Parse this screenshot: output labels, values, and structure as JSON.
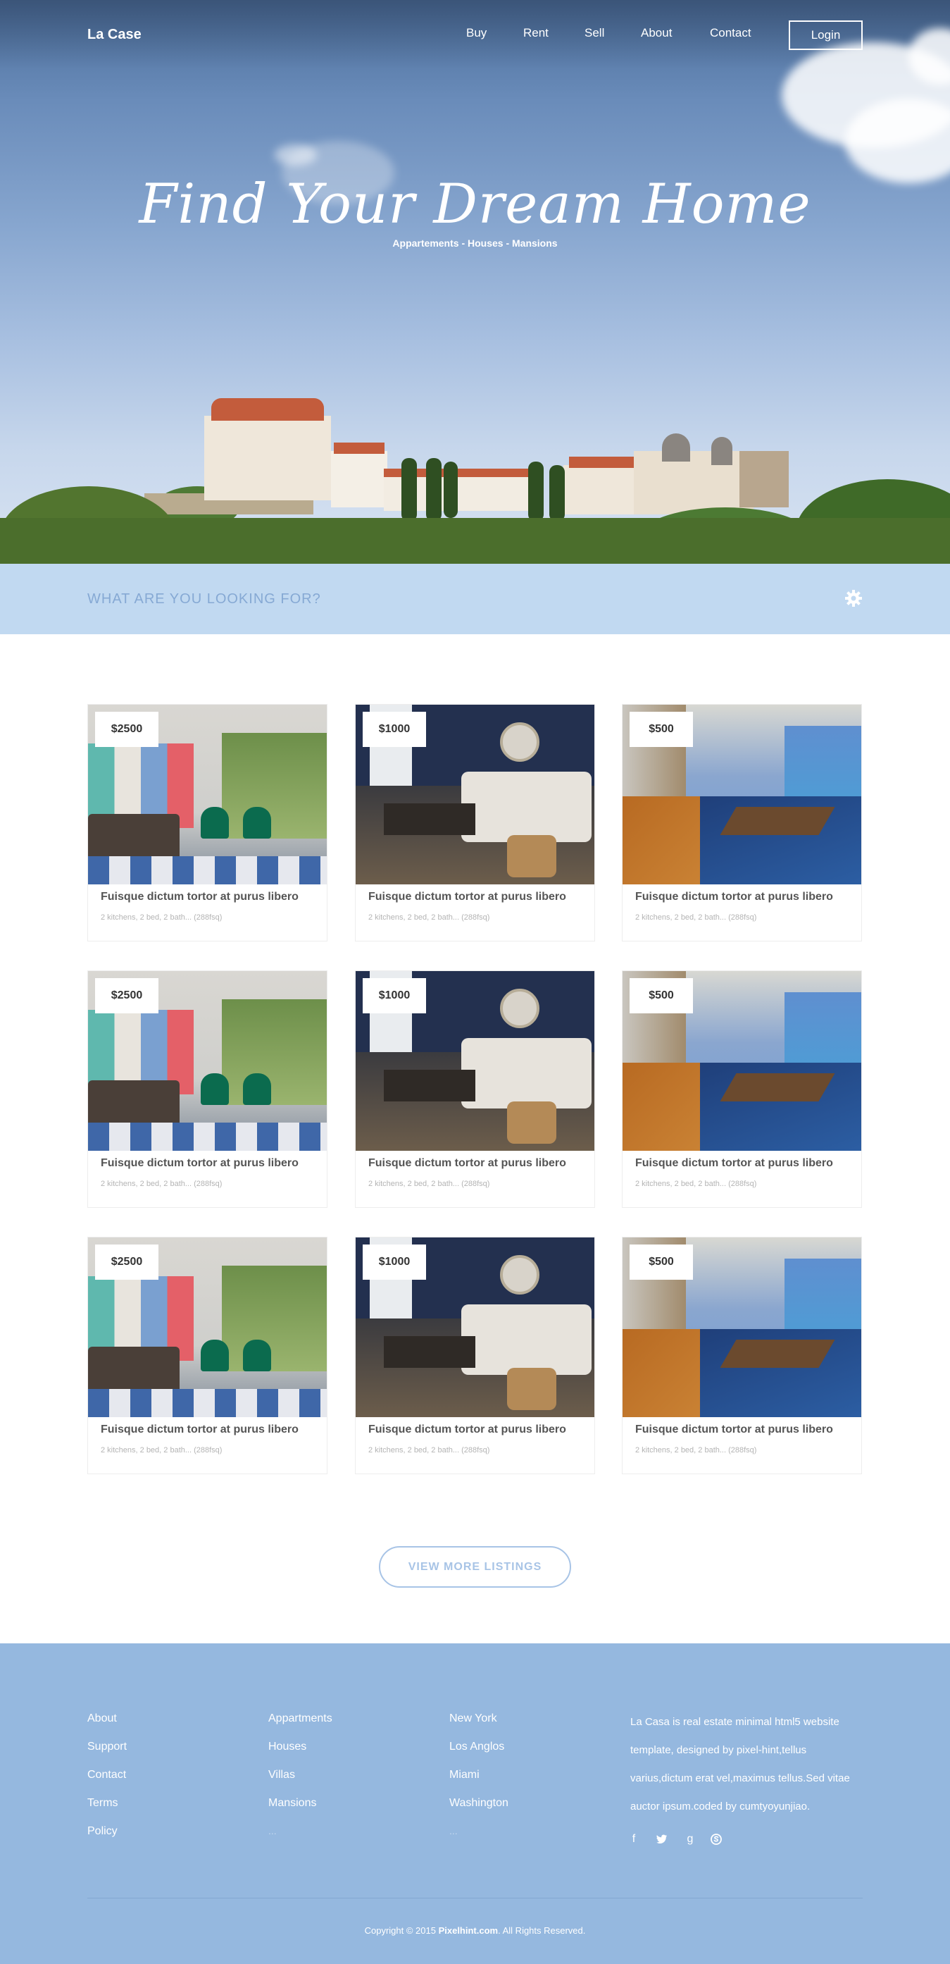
{
  "header": {
    "brand": "La Case",
    "nav": [
      "Buy",
      "Rent",
      "Sell",
      "About",
      "Contact"
    ],
    "login_label": "Login"
  },
  "hero": {
    "title": "Find Your Dream Home",
    "subtitle": "Appartements - Houses - Mansions"
  },
  "search": {
    "label": "WHAT ARE YOU LOOKING FOR?"
  },
  "listings": [
    {
      "price": "$2500",
      "title": "Fuisque dictum tortor at purus libero",
      "desc": "2 kitchens, 2 bed, 2 bath... (288fsq)"
    },
    {
      "price": "$1000",
      "title": "Fuisque dictum tortor at purus libero",
      "desc": "2 kitchens, 2 bed, 2 bath... (288fsq)"
    },
    {
      "price": "$500",
      "title": "Fuisque dictum tortor at purus libero",
      "desc": "2 kitchens, 2 bed, 2 bath... (288fsq)"
    },
    {
      "price": "$2500",
      "title": "Fuisque dictum tortor at purus libero",
      "desc": "2 kitchens, 2 bed, 2 bath... (288fsq)"
    },
    {
      "price": "$1000",
      "title": "Fuisque dictum tortor at purus libero",
      "desc": "2 kitchens, 2 bed, 2 bath... (288fsq)"
    },
    {
      "price": "$500",
      "title": "Fuisque dictum tortor at purus libero",
      "desc": "2 kitchens, 2 bed, 2 bath... (288fsq)"
    },
    {
      "price": "$2500",
      "title": "Fuisque dictum tortor at purus libero",
      "desc": "2 kitchens, 2 bed, 2 bath... (288fsq)"
    },
    {
      "price": "$1000",
      "title": "Fuisque dictum tortor at purus libero",
      "desc": "2 kitchens, 2 bed, 2 bath... (288fsq)"
    },
    {
      "price": "$500",
      "title": "Fuisque dictum tortor at purus libero",
      "desc": "2 kitchens, 2 bed, 2 bath... (288fsq)"
    }
  ],
  "view_more_label": "VIEW MORE LISTINGS",
  "footer": {
    "col1": [
      "About",
      "Support",
      "Contact",
      "Terms",
      "Policy"
    ],
    "col2": [
      "Appartments",
      "Houses",
      "Villas",
      "Mansions",
      "..."
    ],
    "col3": [
      "New York",
      "Los Anglos",
      "Miami",
      "Washington",
      "..."
    ],
    "about_text": "La Casa is real estate minimal html5 website template, designed by pixel-hint,tellus varius,dictum erat vel,maximus tellus.Sed vitae auctor ipsum.coded by cumtyoyunjiao.",
    "social_icons": [
      "facebook-icon",
      "twitter-icon",
      "google-icon",
      "skype-icon"
    ],
    "copyright_prefix": "Copyright © 2015",
    "copyright_site": "Pixelhint.com",
    "copyright_suffix": ". All Rights Reserved."
  },
  "colors": {
    "search_strip": "#c1d9f1",
    "footer_bg": "#95b8df",
    "accent": "#a8c4e6"
  }
}
